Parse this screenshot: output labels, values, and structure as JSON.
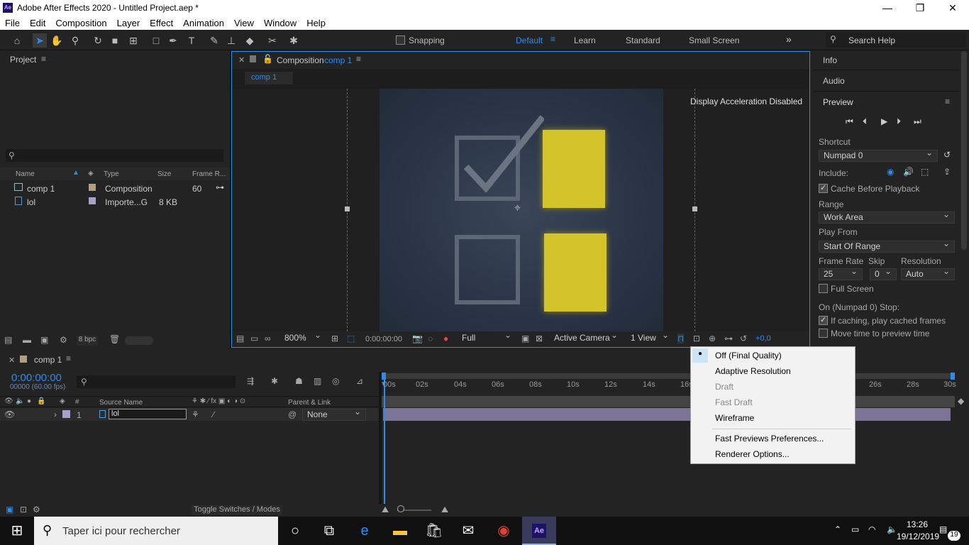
{
  "window": {
    "title": "Adobe After Effects 2020 - Untitled Project.aep *",
    "app_icon": "Ae"
  },
  "menu": [
    "File",
    "Edit",
    "Composition",
    "Layer",
    "Effect",
    "Animation",
    "View",
    "Window",
    "Help"
  ],
  "toolbar": {
    "snapping": "Snapping",
    "workspaces": [
      "Default",
      "Learn",
      "Standard",
      "Small Screen"
    ],
    "search_placeholder": "Search Help"
  },
  "project": {
    "title": "Project",
    "columns": [
      "Name",
      "Type",
      "Size",
      "Frame R..."
    ],
    "rows": [
      {
        "name": "comp 1",
        "type": "Composition",
        "size": "",
        "rate": "60"
      },
      {
        "name": "lol",
        "type": "Importe...G",
        "size": "8 KB",
        "rate": ""
      }
    ],
    "bpc": "8 bpc"
  },
  "composition": {
    "tab_prefix": "Composition",
    "tab_name": "comp 1",
    "breadcrumb": "comp 1",
    "overlay": "Display Acceleration Disabled",
    "zoom": "800%",
    "timecode": "0:00:00:00",
    "resolution": "Full",
    "camera": "Active Camera",
    "views": "1 View",
    "exposure": "+0,0"
  },
  "right_panel": {
    "info": "Info",
    "audio": "Audio",
    "preview": "Preview",
    "shortcut_label": "Shortcut",
    "shortcut": "Numpad 0",
    "include_label": "Include:",
    "cache": "Cache Before Playback",
    "range_label": "Range",
    "range": "Work Area",
    "playfrom_label": "Play From",
    "playfrom": "Start Of Range",
    "framerate_label": "Frame Rate",
    "skip_label": "Skip",
    "resolution_label": "Resolution",
    "framerate": "25",
    "skip": "0",
    "resolution": "Auto",
    "fullscreen": "Full Screen",
    "stop_label": "On (Numpad 0) Stop:",
    "if_caching": "If caching, play cached frames",
    "move_time": "Move time to preview time"
  },
  "timeline": {
    "tab": "comp 1",
    "timecode": "0:00:00:00",
    "fps": "00000 (60.00 fps)",
    "col_source": "Source Name",
    "col_parent": "Parent & Link",
    "layer": {
      "num": "1",
      "name": "lol",
      "parent": "None"
    },
    "ticks": [
      "00s",
      "02s",
      "04s",
      "06s",
      "08s",
      "10s",
      "12s",
      "14s",
      "16s",
      "26s",
      "28s",
      "30s"
    ],
    "toggle": "Toggle Switches / Modes"
  },
  "fast_previews_menu": [
    "Off (Final Quality)",
    "Adaptive Resolution",
    "Draft",
    "Fast Draft",
    "Wireframe",
    "Fast Previews Preferences...",
    "Renderer Options..."
  ],
  "taskbar": {
    "search": "Taper ici pour rechercher",
    "time": "13:26",
    "date": "19/12/2019",
    "notif": "19"
  }
}
